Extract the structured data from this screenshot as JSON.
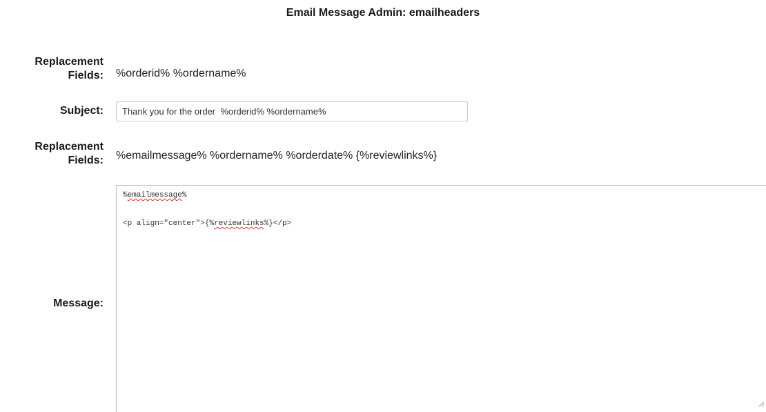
{
  "page": {
    "title": "Email Message Admin: emailheaders"
  },
  "fields": {
    "replacement1": {
      "label_line1": "Replacement",
      "label_line2": "Fields:",
      "value": "%orderid% %ordername%"
    },
    "subject": {
      "label": "Subject:",
      "value": "Thank you for the order  %orderid% %ordername%"
    },
    "replacement2": {
      "label_line1": "Replacement",
      "label_line2": "Fields:",
      "value": "%emailmessage% %ordername% %orderdate% {%reviewlinks%}"
    },
    "message": {
      "label": "Message:",
      "line1": {
        "open": "%",
        "word": "emailmessage",
        "close": "%"
      },
      "line2": {
        "before": "<p align=\"center\">{%",
        "word": "reviewlinks",
        "after": "%}</p>"
      }
    }
  },
  "icons": {
    "resize": "resize-grip-icon"
  }
}
